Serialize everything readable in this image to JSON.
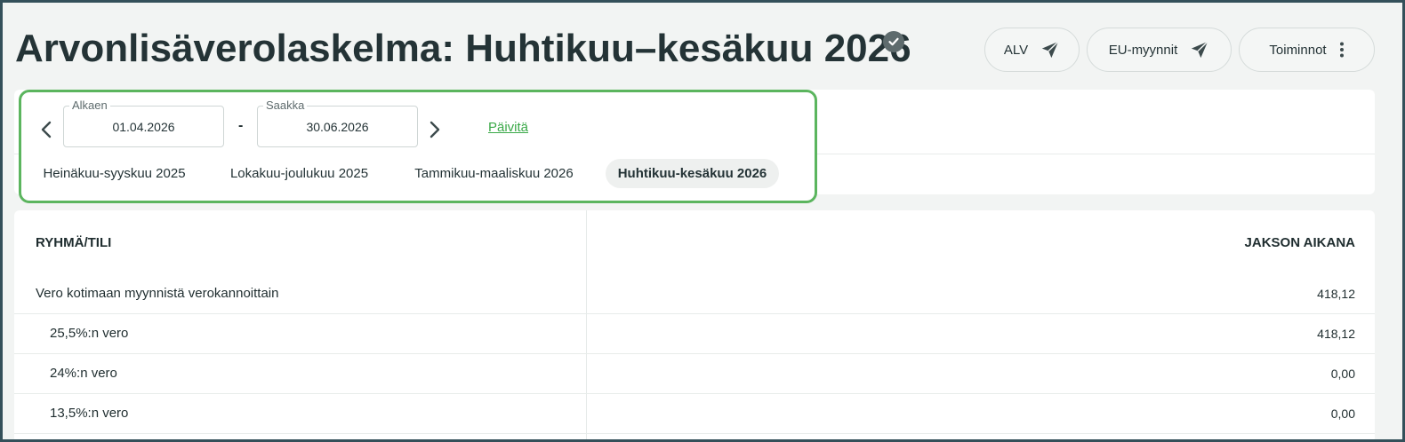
{
  "page": {
    "title_prefix": "Arvonlisäverolaskelma: ",
    "title_period": "Huhtikuu–kesäkuu 2026",
    "verified_icon": "check-circle-icon"
  },
  "actions": {
    "alv_label": "ALV",
    "eu_label": "EU-myynnit",
    "more_label": "Toiminnot",
    "send_icon": "paper-plane-icon",
    "more_icon": "vertical-dots-icon"
  },
  "filter": {
    "start_label": "Alkaen",
    "start_value": "01.04.2026",
    "separator": "-",
    "end_label": "Saakka",
    "end_value": "30.06.2026",
    "refresh_label": "Päivitä",
    "periods": [
      {
        "label": "Heinäkuu-syyskuu 2025",
        "active": false
      },
      {
        "label": "Lokakuu-joulukuu 2025",
        "active": false
      },
      {
        "label": "Tammikuu-maaliskuu 2026",
        "active": false
      },
      {
        "label": "Huhtikuu-kesäkuu 2026",
        "active": true
      }
    ]
  },
  "table": {
    "col_group": "RYHMÄ/TILI",
    "col_period": "JAKSON AIKANA",
    "rows": [
      {
        "label": "Vero kotimaan myynnistä verokannoittain",
        "value": "418,12",
        "indent": false
      },
      {
        "label": "25,5%:n vero",
        "value": "418,12",
        "indent": true
      },
      {
        "label": "24%:n vero",
        "value": "0,00",
        "indent": true
      },
      {
        "label": "13,5%:n vero",
        "value": "0,00",
        "indent": true
      }
    ]
  },
  "colors": {
    "accent_green": "#5bb55e",
    "link_green": "#3aa948",
    "text_dark": "#243336",
    "background": "#f2f4f3"
  }
}
